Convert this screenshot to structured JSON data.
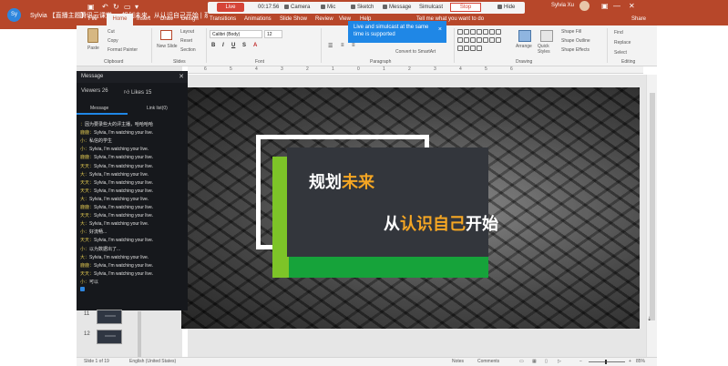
{
  "channel": {
    "avatar": "Sy",
    "title": "Sylvia 【直播主题】",
    "save_title": "腾讯云课堂 — 规划未来，从认识自己开始 | 系统直播：如何做好的专业求职"
  },
  "broadcast": {
    "live": "Live",
    "time": "00:17:56",
    "items": [
      "Camera",
      "Mic",
      "Sketch",
      "Message",
      "Simulcast",
      "Hide"
    ],
    "stop": "Stop"
  },
  "user": {
    "name": "Sylvia Xu"
  },
  "ribbon_tabs": [
    "File",
    "Home",
    "Insert",
    "Draw",
    "Design",
    "Transitions",
    "Animations",
    "Slide Show",
    "Review",
    "View",
    "Help"
  ],
  "tell_me": "Tell me what you want to do",
  "share": "Share",
  "ribbon": {
    "paste": "Paste",
    "cut": "Cut",
    "copy": "Copy",
    "format_painter": "Format Painter",
    "clipboard": "Clipboard",
    "new_slide": "New Slide",
    "layout": "Layout",
    "reset": "Reset",
    "section": "Section",
    "slides": "Slides",
    "font_name": "Calibri (Body)",
    "font_size": "12",
    "font": "Font",
    "paragraph": "Paragraph",
    "convert_smartart": "Convert to SmartArt",
    "drawing": "Drawing",
    "arrange": "Arrange",
    "quick_styles": "Quick Styles",
    "shape_fill": "Shape Fill",
    "shape_outline": "Shape Outline",
    "shape_effects": "Shape Effects",
    "find": "Find",
    "replace": "Replace",
    "select": "Select",
    "editing": "Editing"
  },
  "toast": {
    "text": "Live and simulcast at the same time is supported",
    "close": "×"
  },
  "message_panel": {
    "title": "Message",
    "viewers": "Viewers 26",
    "likes": "Likes 15",
    "tab_message": "Message",
    "tab_link": "Link list(0)",
    "messages": [
      {
        "who": "：",
        "text": "因为要录些大的评主播，哈哈哈哈"
      },
      {
        "who": "鹿鹿：",
        "text": "Sylvia, I'm watching your live."
      },
      {
        "who": "小：",
        "text": "私信的学生"
      },
      {
        "who": "小：",
        "text": "Sylvia, I'm watching your live."
      },
      {
        "who": "鹿鹿：",
        "text": "Sylvia, I'm watching your live."
      },
      {
        "who": "天天：",
        "text": "Sylvia, I'm watching your live."
      },
      {
        "who": "大：",
        "text": "Sylvia, I'm watching your live."
      },
      {
        "who": "天天：",
        "text": "Sylvia, I'm watching your live."
      },
      {
        "who": "天天：",
        "text": "Sylvia, I'm watching your live."
      },
      {
        "who": "大：",
        "text": "Sylvia, I'm watching your live."
      },
      {
        "who": "鹿鹿：",
        "text": "Sylvia, I'm watching your live."
      },
      {
        "who": "天天：",
        "text": "Sylvia, I'm watching your live."
      },
      {
        "who": "大：",
        "text": "Sylvia, I'm watching your live."
      },
      {
        "who": "小：",
        "text": "好流畅..."
      },
      {
        "who": "天天：",
        "text": "Sylvia, I'm watching your live."
      },
      {
        "who": "小：",
        "text": "以为数据出了..."
      },
      {
        "who": "大：",
        "text": "Sylvia, I'm watching your live."
      },
      {
        "who": "鹿鹿：",
        "text": "Sylvia, I'm watching your live."
      },
      {
        "who": "天天：",
        "text": "Sylvia, I'm watching your live."
      },
      {
        "who": "小：",
        "text": "可以"
      },
      {
        "who": "",
        "text": ""
      }
    ]
  },
  "thumbnails": {
    "n1": "11",
    "n2": "12"
  },
  "slide": {
    "line1_a": "规划",
    "line1_b": "未来",
    "line2_a": "从",
    "line2_b": "认识自己",
    "line2_c": "开始"
  },
  "status": {
    "slide": "Slide 1 of 19",
    "language": "English (United States)",
    "notes": "Notes",
    "comments": "Comments",
    "zoom": "85%"
  },
  "colors": {
    "title_bar": "#b7472a",
    "accent_blue": "#1f87e6",
    "live_red": "#d64438",
    "slide_green": "#16a33a",
    "slide_orange": "#f5a623"
  }
}
